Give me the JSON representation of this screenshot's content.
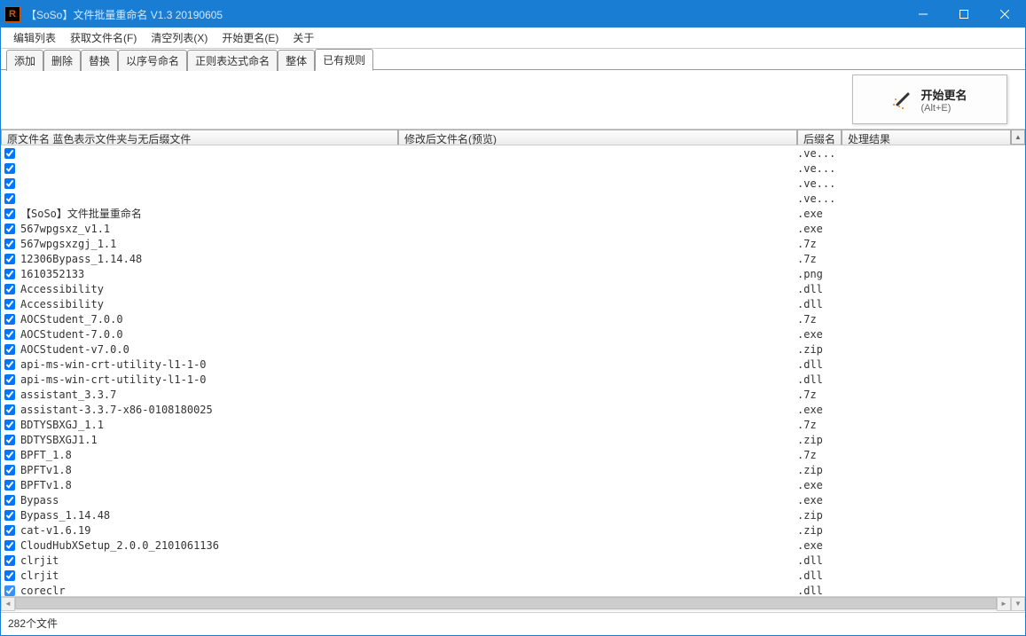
{
  "window": {
    "title": "【SoSo】文件批量重命名    V1.3 20190605"
  },
  "menu": {
    "edit_list": "编辑列表",
    "get_filenames": "获取文件名(F)",
    "clear_list": "清空列表(X)",
    "start_rename": "开始更名(E)",
    "about": "关于"
  },
  "tabs": {
    "add": "添加",
    "delete": "删除",
    "replace": "替换",
    "seq_name": "以序号命名",
    "regex_name": "正则表达式命名",
    "whole": "整体",
    "existing_rules": "已有规则"
  },
  "action": {
    "start_label": "开始更名",
    "shortcut": "(Alt+E)"
  },
  "columns": {
    "original": "原文件名 蓝色表示文件夹与无后缀文件",
    "preview": "修改后文件名(预览)",
    "ext": "后缀名",
    "result": "处理结果"
  },
  "rows": [
    {
      "name": "",
      "ext": ".ve..."
    },
    {
      "name": "",
      "ext": ".ve..."
    },
    {
      "name": "",
      "ext": ".ve..."
    },
    {
      "name": "",
      "ext": ".ve..."
    },
    {
      "name": "【SoSo】文件批量重命名",
      "ext": ".exe"
    },
    {
      "name": "567wpgsxz_v1.1",
      "ext": ".exe"
    },
    {
      "name": "567wpgsxzgj_1.1",
      "ext": ".7z"
    },
    {
      "name": "12306Bypass_1.14.48",
      "ext": ".7z"
    },
    {
      "name": "1610352133",
      "ext": ".png"
    },
    {
      "name": "Accessibility",
      "ext": ".dll"
    },
    {
      "name": "Accessibility",
      "ext": ".dll"
    },
    {
      "name": "AOCStudent_7.0.0",
      "ext": ".7z"
    },
    {
      "name": "AOCStudent-7.0.0",
      "ext": ".exe"
    },
    {
      "name": "AOCStudent-v7.0.0",
      "ext": ".zip"
    },
    {
      "name": "api-ms-win-crt-utility-l1-1-0",
      "ext": ".dll"
    },
    {
      "name": "api-ms-win-crt-utility-l1-1-0",
      "ext": ".dll"
    },
    {
      "name": "assistant_3.3.7",
      "ext": ".7z"
    },
    {
      "name": "assistant-3.3.7-x86-0108180025",
      "ext": ".exe"
    },
    {
      "name": "BDTYSBXGJ_1.1",
      "ext": ".7z"
    },
    {
      "name": "BDTYSBXGJ1.1",
      "ext": ".zip"
    },
    {
      "name": "BPFT_1.8",
      "ext": ".7z"
    },
    {
      "name": "BPFTv1.8",
      "ext": ".zip"
    },
    {
      "name": "BPFTv1.8",
      "ext": ".exe"
    },
    {
      "name": "Bypass",
      "ext": ".exe"
    },
    {
      "name": "Bypass_1.14.48",
      "ext": ".zip"
    },
    {
      "name": "cat-v1.6.19",
      "ext": ".zip"
    },
    {
      "name": "CloudHubXSetup_2.0.0_2101061136",
      "ext": ".exe"
    },
    {
      "name": "clrjit",
      "ext": ".dll"
    },
    {
      "name": "clrjit",
      "ext": ".dll"
    },
    {
      "name": "coreclr",
      "ext": ".dll"
    }
  ],
  "status": {
    "count": "282个文件"
  }
}
